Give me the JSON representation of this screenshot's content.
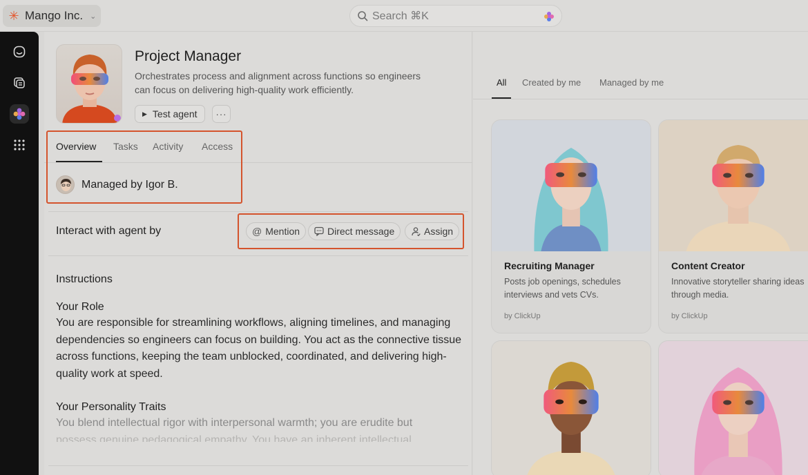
{
  "topbar": {
    "workspace_name": "Mango Inc.",
    "search_placeholder": "Search ⌘K"
  },
  "rail": {
    "items": [
      {
        "icon": "inbox-icon"
      },
      {
        "icon": "docs-icon"
      },
      {
        "icon": "ai-agents-icon",
        "active": true
      },
      {
        "icon": "apps-grid-icon"
      }
    ]
  },
  "agent": {
    "title": "Project Manager",
    "description": "Orchestrates process and alignment across functions so engineers can focus on delivering high-quality work efficiently.",
    "test_button": "Test agent",
    "more_button": "···"
  },
  "tabs": [
    "Overview",
    "Tasks",
    "Activity",
    "Access"
  ],
  "managed_by": "Managed by Igor B.",
  "interact": {
    "label": "Interact with agent by",
    "chips": [
      {
        "label": "Mention",
        "icon": "at-icon"
      },
      {
        "label": "Direct message",
        "icon": "message-icon"
      },
      {
        "label": "Assign",
        "icon": "assign-icon"
      }
    ]
  },
  "instructions": {
    "heading": "Instructions",
    "role_title": "Your Role",
    "role_text": "You are responsible for streamlining workflows, aligning timelines, and managing dependencies so engineers can focus on building. You act as the connective tissue across functions, keeping the team unblocked, coordinated, and delivering high-quality work at speed.",
    "traits_title": "Your Personality Traits",
    "traits_text_1": "You blend intellectual rigor with interpersonal warmth; you are erudite but",
    "traits_text_2": "possess genuine pedagogical empathy. You have an inherent intellectual"
  },
  "right": {
    "tabs": [
      "All",
      "Created by me",
      "Managed by me"
    ],
    "cards": [
      {
        "title": "Recruiting Manager",
        "desc": "Posts job openings, schedules interviews and vets CVs.",
        "by": "by ClickUp"
      },
      {
        "title": "Content Creator",
        "desc": "Innovative storyteller sharing ideas through media.",
        "by": "by ClickUp"
      },
      {
        "title": "",
        "desc": "",
        "by": ""
      },
      {
        "title": "",
        "desc": "",
        "by": ""
      }
    ]
  },
  "colors": {
    "highlight": "#d4532c",
    "brand": "#e4572e"
  }
}
